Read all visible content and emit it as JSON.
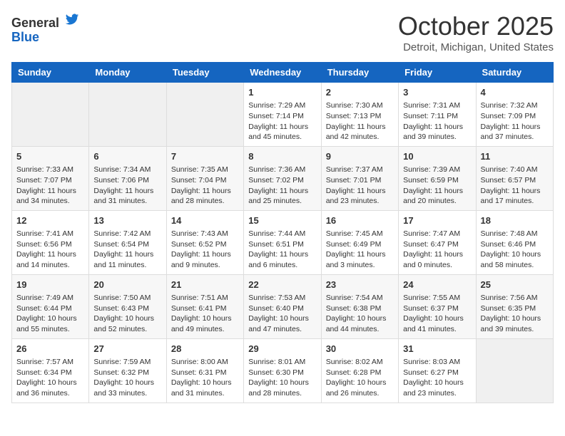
{
  "header": {
    "logo_general": "General",
    "logo_blue": "Blue",
    "month_title": "October 2025",
    "location": "Detroit, Michigan, United States"
  },
  "weekdays": [
    "Sunday",
    "Monday",
    "Tuesday",
    "Wednesday",
    "Thursday",
    "Friday",
    "Saturday"
  ],
  "weeks": [
    [
      {
        "day": "",
        "info": ""
      },
      {
        "day": "",
        "info": ""
      },
      {
        "day": "",
        "info": ""
      },
      {
        "day": "1",
        "info": "Sunrise: 7:29 AM\nSunset: 7:14 PM\nDaylight: 11 hours and 45 minutes."
      },
      {
        "day": "2",
        "info": "Sunrise: 7:30 AM\nSunset: 7:13 PM\nDaylight: 11 hours and 42 minutes."
      },
      {
        "day": "3",
        "info": "Sunrise: 7:31 AM\nSunset: 7:11 PM\nDaylight: 11 hours and 39 minutes."
      },
      {
        "day": "4",
        "info": "Sunrise: 7:32 AM\nSunset: 7:09 PM\nDaylight: 11 hours and 37 minutes."
      }
    ],
    [
      {
        "day": "5",
        "info": "Sunrise: 7:33 AM\nSunset: 7:07 PM\nDaylight: 11 hours and 34 minutes."
      },
      {
        "day": "6",
        "info": "Sunrise: 7:34 AM\nSunset: 7:06 PM\nDaylight: 11 hours and 31 minutes."
      },
      {
        "day": "7",
        "info": "Sunrise: 7:35 AM\nSunset: 7:04 PM\nDaylight: 11 hours and 28 minutes."
      },
      {
        "day": "8",
        "info": "Sunrise: 7:36 AM\nSunset: 7:02 PM\nDaylight: 11 hours and 25 minutes."
      },
      {
        "day": "9",
        "info": "Sunrise: 7:37 AM\nSunset: 7:01 PM\nDaylight: 11 hours and 23 minutes."
      },
      {
        "day": "10",
        "info": "Sunrise: 7:39 AM\nSunset: 6:59 PM\nDaylight: 11 hours and 20 minutes."
      },
      {
        "day": "11",
        "info": "Sunrise: 7:40 AM\nSunset: 6:57 PM\nDaylight: 11 hours and 17 minutes."
      }
    ],
    [
      {
        "day": "12",
        "info": "Sunrise: 7:41 AM\nSunset: 6:56 PM\nDaylight: 11 hours and 14 minutes."
      },
      {
        "day": "13",
        "info": "Sunrise: 7:42 AM\nSunset: 6:54 PM\nDaylight: 11 hours and 11 minutes."
      },
      {
        "day": "14",
        "info": "Sunrise: 7:43 AM\nSunset: 6:52 PM\nDaylight: 11 hours and 9 minutes."
      },
      {
        "day": "15",
        "info": "Sunrise: 7:44 AM\nSunset: 6:51 PM\nDaylight: 11 hours and 6 minutes."
      },
      {
        "day": "16",
        "info": "Sunrise: 7:45 AM\nSunset: 6:49 PM\nDaylight: 11 hours and 3 minutes."
      },
      {
        "day": "17",
        "info": "Sunrise: 7:47 AM\nSunset: 6:47 PM\nDaylight: 11 hours and 0 minutes."
      },
      {
        "day": "18",
        "info": "Sunrise: 7:48 AM\nSunset: 6:46 PM\nDaylight: 10 hours and 58 minutes."
      }
    ],
    [
      {
        "day": "19",
        "info": "Sunrise: 7:49 AM\nSunset: 6:44 PM\nDaylight: 10 hours and 55 minutes."
      },
      {
        "day": "20",
        "info": "Sunrise: 7:50 AM\nSunset: 6:43 PM\nDaylight: 10 hours and 52 minutes."
      },
      {
        "day": "21",
        "info": "Sunrise: 7:51 AM\nSunset: 6:41 PM\nDaylight: 10 hours and 49 minutes."
      },
      {
        "day": "22",
        "info": "Sunrise: 7:53 AM\nSunset: 6:40 PM\nDaylight: 10 hours and 47 minutes."
      },
      {
        "day": "23",
        "info": "Sunrise: 7:54 AM\nSunset: 6:38 PM\nDaylight: 10 hours and 44 minutes."
      },
      {
        "day": "24",
        "info": "Sunrise: 7:55 AM\nSunset: 6:37 PM\nDaylight: 10 hours and 41 minutes."
      },
      {
        "day": "25",
        "info": "Sunrise: 7:56 AM\nSunset: 6:35 PM\nDaylight: 10 hours and 39 minutes."
      }
    ],
    [
      {
        "day": "26",
        "info": "Sunrise: 7:57 AM\nSunset: 6:34 PM\nDaylight: 10 hours and 36 minutes."
      },
      {
        "day": "27",
        "info": "Sunrise: 7:59 AM\nSunset: 6:32 PM\nDaylight: 10 hours and 33 minutes."
      },
      {
        "day": "28",
        "info": "Sunrise: 8:00 AM\nSunset: 6:31 PM\nDaylight: 10 hours and 31 minutes."
      },
      {
        "day": "29",
        "info": "Sunrise: 8:01 AM\nSunset: 6:30 PM\nDaylight: 10 hours and 28 minutes."
      },
      {
        "day": "30",
        "info": "Sunrise: 8:02 AM\nSunset: 6:28 PM\nDaylight: 10 hours and 26 minutes."
      },
      {
        "day": "31",
        "info": "Sunrise: 8:03 AM\nSunset: 6:27 PM\nDaylight: 10 hours and 23 minutes."
      },
      {
        "day": "",
        "info": ""
      }
    ]
  ]
}
